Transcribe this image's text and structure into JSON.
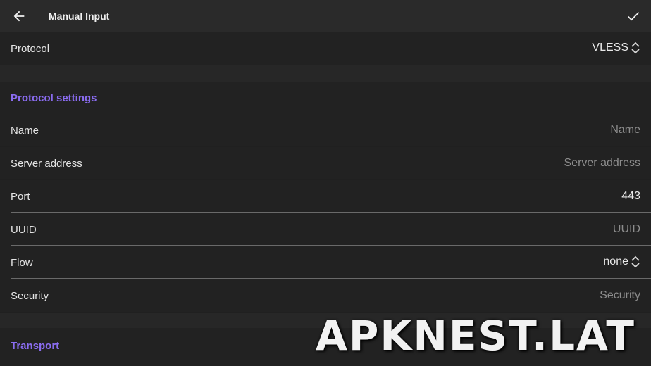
{
  "appbar": {
    "title": "Manual Input",
    "back_icon": "arrow-left-icon",
    "confirm_icon": "check-icon"
  },
  "protocol": {
    "label": "Protocol",
    "value": "VLESS",
    "icon": "unfold-icon"
  },
  "protocol_settings": {
    "header": "Protocol settings",
    "fields": [
      {
        "label": "Name",
        "placeholder": "Name",
        "value": ""
      },
      {
        "label": "Server address",
        "placeholder": "Server address",
        "value": ""
      },
      {
        "label": "Port",
        "placeholder": "",
        "value": "443"
      },
      {
        "label": "UUID",
        "placeholder": "UUID",
        "value": ""
      },
      {
        "label": "Flow",
        "value": "none",
        "icon": "unfold-icon"
      },
      {
        "label": "Security",
        "placeholder": "Security",
        "value": ""
      }
    ]
  },
  "transport": {
    "header": "Transport"
  },
  "watermark": "APKNEST.LAT",
  "colors": {
    "accent": "#8a6cf0",
    "background": "#202020",
    "appbar": "#2a2a2a"
  }
}
